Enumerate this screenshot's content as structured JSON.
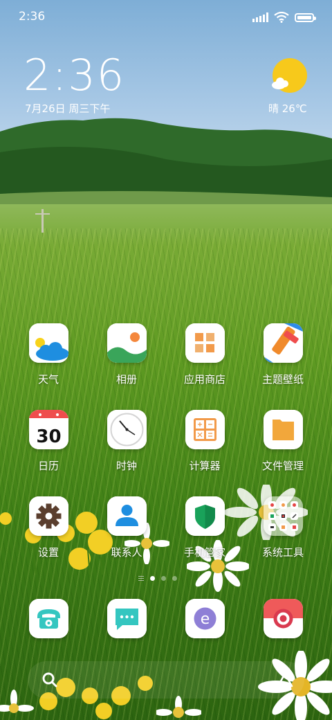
{
  "status_bar": {
    "time": "2:36",
    "battery_level": 1.0
  },
  "clock_widget": {
    "time": "2:36",
    "date": "7月26日 周三下午"
  },
  "weather_widget": {
    "text": "晴 26℃",
    "icon": "sunny-cloud-icon"
  },
  "apps": [
    {
      "label": "天气",
      "icon": "weather-app-icon"
    },
    {
      "label": "相册",
      "icon": "gallery-app-icon"
    },
    {
      "label": "应用商店",
      "icon": "app-store-icon"
    },
    {
      "label": "主题壁纸",
      "icon": "themes-app-icon"
    },
    {
      "label": "日历",
      "icon": "calendar-app-icon",
      "badge_text": "30"
    },
    {
      "label": "时钟",
      "icon": "clock-app-icon"
    },
    {
      "label": "计算器",
      "icon": "calculator-app-icon"
    },
    {
      "label": "文件管理",
      "icon": "file-manager-icon"
    },
    {
      "label": "设置",
      "icon": "settings-app-icon"
    },
    {
      "label": "联系人",
      "icon": "contacts-app-icon"
    },
    {
      "label": "手机管家",
      "icon": "security-app-icon"
    },
    {
      "label": "系统工具",
      "icon": "system-tools-folder-icon"
    }
  ],
  "page_indicator": {
    "pages": 3,
    "active": 1
  },
  "dock": [
    {
      "icon": "phone-app-icon"
    },
    {
      "icon": "messages-app-icon"
    },
    {
      "icon": "browser-app-icon"
    },
    {
      "icon": "camera-app-icon"
    }
  ],
  "search": {
    "icon": "search-icon",
    "assistant_icon": "assistant-icon"
  },
  "colors": {
    "accent_orange": "#f4a23a",
    "calendar_red": "#ef4d4d",
    "teal": "#34c6c0",
    "security_green": "#19a25a"
  }
}
